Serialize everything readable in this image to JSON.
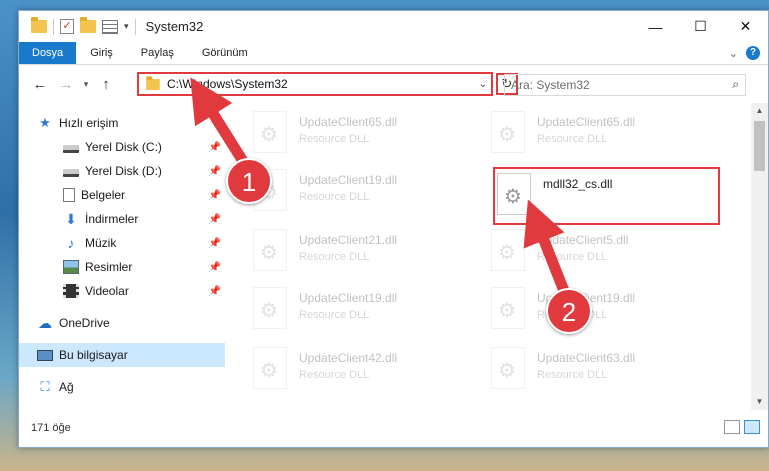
{
  "window": {
    "title": "System32"
  },
  "ribbon": {
    "tabs": [
      "Dosya",
      "Giriş",
      "Paylaş",
      "Görünüm"
    ],
    "help": "?"
  },
  "nav": {
    "address_path": "C:\\Windows\\System32",
    "search_placeholder": "Ara: System32"
  },
  "sidebar": {
    "items": [
      {
        "label": "Hızlı erişim",
        "icon": "star-icon"
      },
      {
        "label": "Yerel Disk (C:)",
        "icon": "drive-icon",
        "pinned": true
      },
      {
        "label": "Yerel Disk (D:)",
        "icon": "drive-icon",
        "pinned": true
      },
      {
        "label": "Belgeler",
        "icon": "document-icon",
        "pinned": true
      },
      {
        "label": "İndirmeler",
        "icon": "download-icon",
        "pinned": true
      },
      {
        "label": "Müzik",
        "icon": "music-icon",
        "pinned": true
      },
      {
        "label": "Resimler",
        "icon": "pictures-icon",
        "pinned": true
      },
      {
        "label": "Videolar",
        "icon": "video-icon",
        "pinned": true
      },
      {
        "label": "OneDrive",
        "icon": "cloud-icon"
      },
      {
        "label": "Bu bilgisayar",
        "icon": "computer-icon",
        "selected": true
      },
      {
        "label": "Ağ",
        "icon": "network-icon"
      }
    ]
  },
  "files": [
    {
      "name": "UpdateClient65.dll",
      "type": "Resource DLL"
    },
    {
      "name": "UpdateClient65.dll",
      "type": "Resource DLL"
    },
    {
      "name": "UpdateClient19.dll",
      "type": "Resource DLL"
    },
    {
      "name": "mdll32_cs.dll",
      "type": ""
    },
    {
      "name": "UpdateClient21.dll",
      "type": "Resource DLL"
    },
    {
      "name": "UpdateClient5.dll",
      "type": "Resource DLL"
    },
    {
      "name": "UpdateClient19.dll",
      "type": "Resource DLL"
    },
    {
      "name": "UpdateClient19.dll",
      "type": "Resource DLL"
    },
    {
      "name": "UpdateClient42.dll",
      "type": "Resource DLL"
    },
    {
      "name": "UpdateClient63.dll",
      "type": "Resource DLL"
    }
  ],
  "status": {
    "item_count": "171 öğe"
  },
  "annotations": {
    "step1": "1",
    "step2": "2",
    "color": "#e0393e"
  }
}
